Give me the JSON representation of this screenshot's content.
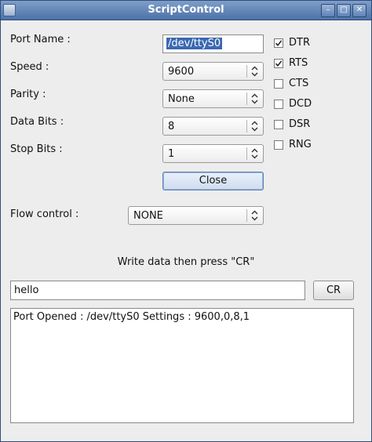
{
  "window": {
    "title": "ScriptControl"
  },
  "form": {
    "port_name_label": "Port Name :",
    "port_name_value": "/dev/ttyS0",
    "speed_label": "Speed :",
    "speed_value": "9600",
    "parity_label": "Parity :",
    "parity_value": "None",
    "data_bits_label": "Data Bits :",
    "data_bits_value": "8",
    "stop_bits_label": "Stop Bits :",
    "stop_bits_value": "1",
    "close_button": "Close",
    "flow_control_label": "Flow control :",
    "flow_control_value": "NONE"
  },
  "signals": [
    {
      "label": "DTR",
      "checked": true
    },
    {
      "label": "RTS",
      "checked": true
    },
    {
      "label": "CTS",
      "checked": false
    },
    {
      "label": "DCD",
      "checked": false
    },
    {
      "label": "DSR",
      "checked": false
    },
    {
      "label": "RNG",
      "checked": false
    }
  ],
  "console": {
    "instruction": "Write data then press \"CR\"",
    "input_value": "hello",
    "cr_button": "CR",
    "output_text": "Port Opened : /dev/ttyS0 Settings : 9600,0,8,1"
  }
}
